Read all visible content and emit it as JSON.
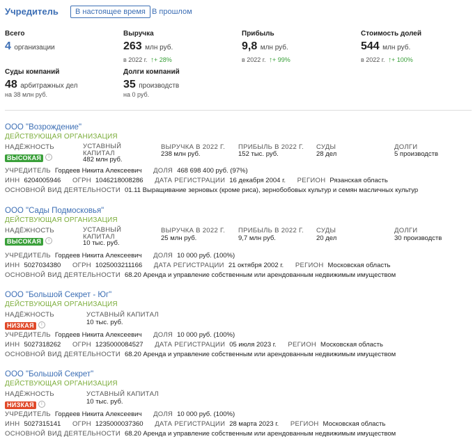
{
  "header": {
    "title": "Учредитель",
    "tab_current": "В настоящее время",
    "tab_past": "В прошлом"
  },
  "stats": {
    "total": {
      "label": "Всего",
      "value": "4",
      "unit": "организации"
    },
    "revenue": {
      "label": "Выручка",
      "value": "263",
      "unit": "млн руб.",
      "sub": "в 2022 г.",
      "growth": "+ 28%"
    },
    "profit": {
      "label": "Прибыль",
      "value": "9,8",
      "unit": "млн руб.",
      "sub": "в 2022 г.",
      "growth": "+ 99%"
    },
    "shares": {
      "label": "Стоимость долей",
      "value": "544",
      "unit": "млн руб.",
      "sub": "в 2022 г.",
      "growth": "+ 100%"
    },
    "courts": {
      "label": "Суды компаний",
      "value": "48",
      "unit": "арбитражных дел",
      "sub": "на 38 млн руб."
    },
    "debts": {
      "label": "Долги компаний",
      "value": "35",
      "unit": "производств",
      "sub": "на 0 руб."
    }
  },
  "companies": [
    {
      "name": "ООО \"Возрождение\"",
      "status": "ДЕЙСТВУЮЩАЯ ОРГАНИЗАЦИЯ",
      "reliability_label": "НАДЁЖНОСТЬ",
      "reliability": "ВЫСОКАЯ",
      "capital_label": "УСТАВНЫЙ КАПИТАЛ",
      "capital": "482 млн руб.",
      "revenue_label": "ВЫРУЧКА В 2022 Г.",
      "revenue": "238 млн руб.",
      "profit_label": "ПРИБЫЛЬ В 2022 Г.",
      "profit": "152 тыс. руб.",
      "courts_label": "СУДЫ",
      "courts": "28 дел",
      "debts_label": "ДОЛГИ",
      "debts": "5 производств",
      "founder_label": "УЧРЕДИТЕЛЬ",
      "founder": "Гордеев Никита Алексеевич",
      "share_label": "ДОЛЯ",
      "share": "468 698 400 руб. (97%)",
      "inn_label": "ИНН",
      "inn": "6204005946",
      "ogrn_label": "ОГРН",
      "ogrn": "1046218008286",
      "regdate_label": "ДАТА РЕГИСТРАЦИИ",
      "regdate": "16 декабря 2004 г.",
      "region_label": "РЕГИОН",
      "region": "Рязанская область",
      "activity_label": "ОСНОВНОЙ ВИД ДЕЯТЕЛЬНОСТИ",
      "activity": "01.11 Выращивание зерновых (кроме риса), зернобобовых культур и семян масличных культур"
    },
    {
      "name": "ООО \"Сады Подмосковья\"",
      "status": "ДЕЙСТВУЮЩАЯ ОРГАНИЗАЦИЯ",
      "reliability_label": "НАДЁЖНОСТЬ",
      "reliability": "ВЫСОКАЯ",
      "capital_label": "УСТАВНЫЙ КАПИТАЛ",
      "capital": "10 тыс. руб.",
      "revenue_label": "ВЫРУЧКА В 2022 Г.",
      "revenue": "25 млн руб.",
      "profit_label": "ПРИБЫЛЬ В 2022 Г.",
      "profit": "9,7 млн руб.",
      "courts_label": "СУДЫ",
      "courts": "20 дел",
      "debts_label": "ДОЛГИ",
      "debts": "30 производств",
      "founder_label": "УЧРЕДИТЕЛЬ",
      "founder": "Гордеев Никита Алексеевич",
      "share_label": "ДОЛЯ",
      "share": "10 000 руб. (100%)",
      "inn_label": "ИНН",
      "inn": "5027034380",
      "ogrn_label": "ОГРН",
      "ogrn": "1025003211166",
      "regdate_label": "ДАТА РЕГИСТРАЦИИ",
      "regdate": "21 октября 2002 г.",
      "region_label": "РЕГИОН",
      "region": "Московская область",
      "activity_label": "ОСНОВНОЙ ВИД ДЕЯТЕЛЬНОСТИ",
      "activity": "68.20 Аренда и управление собственным или арендованным недвижимым имуществом"
    },
    {
      "name": "ООО \"Большой Секрет - Юг\"",
      "status": "ДЕЙСТВУЮЩАЯ ОРГАНИЗАЦИЯ",
      "reliability_label": "НАДЁЖНОСТЬ",
      "reliability": "НИЗКАЯ",
      "capital_label": "УСТАВНЫЙ КАПИТАЛ",
      "capital": "10 тыс. руб.",
      "founder_label": "УЧРЕДИТЕЛЬ",
      "founder": "Гордеев Никита Алексеевич",
      "share_label": "ДОЛЯ",
      "share": "10 000 руб. (100%)",
      "inn_label": "ИНН",
      "inn": "5027318262",
      "ogrn_label": "ОГРН",
      "ogrn": "1235000084527",
      "regdate_label": "ДАТА РЕГИСТРАЦИИ",
      "regdate": "05 июля 2023 г.",
      "region_label": "РЕГИОН",
      "region": "Московская область",
      "activity_label": "ОСНОВНОЙ ВИД ДЕЯТЕЛЬНОСТИ",
      "activity": "68.20 Аренда и управление собственным или арендованным недвижимым имуществом"
    },
    {
      "name": "ООО \"Большой Секрет\"",
      "status": "ДЕЙСТВУЮЩАЯ ОРГАНИЗАЦИЯ",
      "reliability_label": "НАДЁЖНОСТЬ",
      "reliability": "НИЗКАЯ",
      "capital_label": "УСТАВНЫЙ КАПИТАЛ",
      "capital": "10 тыс. руб.",
      "founder_label": "УЧРЕДИТЕЛЬ",
      "founder": "Гордеев Никита Алексеевич",
      "share_label": "ДОЛЯ",
      "share": "10 000 руб. (100%)",
      "inn_label": "ИНН",
      "inn": "5027315141",
      "ogrn_label": "ОГРН",
      "ogrn": "1235000037360",
      "regdate_label": "ДАТА РЕГИСТРАЦИИ",
      "regdate": "28 марта 2023 г.",
      "region_label": "РЕГИОН",
      "region": "Московская область",
      "activity_label": "ОСНОВНОЙ ВИД ДЕЯТЕЛЬНОСТИ",
      "activity": "68.20 Аренда и управление собственным или арендованным недвижимым имуществом"
    }
  ],
  "colors": {
    "link": "#3d6fb5",
    "status_green": "#7cad3c",
    "badge_high": "#3aa03a",
    "badge_low": "#e04a2a",
    "growth": "#3aa03a"
  }
}
